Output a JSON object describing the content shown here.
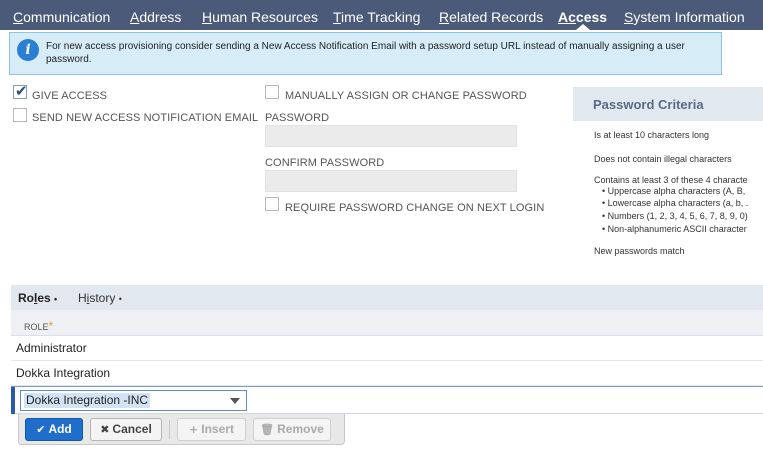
{
  "tabs": [
    {
      "label": "Communication",
      "underline": "C",
      "rest": "ommunication"
    },
    {
      "label": "Address",
      "underline": "A",
      "rest": "ddress"
    },
    {
      "label": "Human Resources",
      "underline": "H",
      "rest": "uman Resources"
    },
    {
      "label": "Time Tracking",
      "underline": "T",
      "rest": "ime Tracking"
    },
    {
      "label": "Related Records",
      "underline": "R",
      "rest": "elated Records"
    },
    {
      "label": "Access",
      "underline": "Ac",
      "rest": "cess"
    },
    {
      "label": "System Information",
      "underline": "S",
      "rest": "ystem Information"
    }
  ],
  "active_tab": "Access",
  "info": {
    "icon": "info-icon",
    "text": "For new access provisioning consider sending a New Access Notification Email with a password setup URL instead of manually assigning a user password."
  },
  "access": {
    "give_access": {
      "label": "GIVE ACCESS",
      "checked": true
    },
    "send_notification": {
      "label": "SEND NEW ACCESS NOTIFICATION EMAIL",
      "checked": false
    },
    "manual_password": {
      "label": "MANUALLY ASSIGN OR CHANGE PASSWORD",
      "checked": false
    },
    "password_label": "PASSWORD",
    "password_value": "",
    "confirm_label": "CONFIRM PASSWORD",
    "confirm_value": "",
    "require_change": {
      "label": "REQUIRE PASSWORD CHANGE ON NEXT LOGIN",
      "checked": false
    }
  },
  "criteria": {
    "title": "Password Criteria",
    "items": [
      "Is at least 10 characters long",
      "Does not contain illegal characters",
      "Contains at least 3 of these 4 characte"
    ],
    "sub_items": [
      "• Uppercase alpha characters (A, B,",
      "• Lowercase alpha characters (a, b, .",
      "• Numbers (1, 2, 3, 4, 5, 6, 7, 8, 9, 0)",
      "• Non-alphanumeric ASCII character"
    ],
    "match": "New passwords match"
  },
  "roles": {
    "tabs": [
      {
        "label": "Roles",
        "underline": "l",
        "before": "Ro",
        "after": "es",
        "bullet": "•"
      },
      {
        "label": "History",
        "underline": "i",
        "before": "H",
        "after": "story",
        "bullet": "•"
      }
    ],
    "column": "ROLE",
    "required_mark": "*",
    "rows": [
      "Administrator",
      "Dokka Integration"
    ],
    "editing_value": "Dokka Integration -INC",
    "buttons": {
      "add": "Add",
      "cancel": "Cancel",
      "insert": "Insert",
      "remove": "Remove"
    }
  }
}
